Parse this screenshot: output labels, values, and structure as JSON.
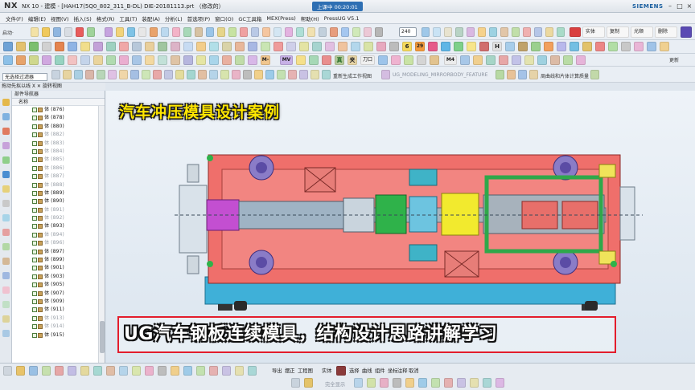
{
  "app": {
    "logo": "NX",
    "title": "NX 10 - 建模 - [HAH17(5Q0_802_311_B-DL) DIE-20181113.prt （修改的）",
    "timer": "上课中 00:20:01",
    "brand": "SIEMENS"
  },
  "menu": [
    "文件(F)",
    "编辑(E)",
    "视图(V)",
    "插入(S)",
    "格式(R)",
    "工具(T)",
    "装配(A)",
    "分析(L)",
    "首选项(P)",
    "窗口(O)",
    "GC工具箱",
    "MEX(Press)",
    "帮助(H)",
    "PressUG V5.1"
  ],
  "toolbar": {
    "start_label": "启动·",
    "zoom_value": "240",
    "right_labels": [
      "实体",
      "复制",
      "光顺",
      "删除"
    ],
    "row3_right": "更新",
    "row4_labels": [
      "重新生成工作视图",
      "UG_MODELING_MIRRORBODY_FEATURE",
      "周曲线和片体计算质量"
    ],
    "glyphs": [
      "6",
      "29",
      "H",
      "M-",
      "MV",
      "真",
      "夹",
      "刀口",
      "M4"
    ]
  },
  "filter": {
    "label": "无选择过滤器"
  },
  "selector": {
    "label": "拖动先拟以线 X ✕ 旋转视图"
  },
  "navigator": {
    "header": "部件导航器",
    "column": "名称",
    "rows": [
      {
        "label": "体 (876)",
        "muted": false
      },
      {
        "label": "体 (878)",
        "muted": false
      },
      {
        "label": "体 (880)",
        "muted": false
      },
      {
        "label": "体 (882)",
        "muted": true
      },
      {
        "label": "体 (883)",
        "muted": true
      },
      {
        "label": "体 (884)",
        "muted": true
      },
      {
        "label": "体 (885)",
        "muted": true
      },
      {
        "label": "体 (886)",
        "muted": true
      },
      {
        "label": "体 (887)",
        "muted": true
      },
      {
        "label": "体 (888)",
        "muted": true
      },
      {
        "label": "体 (889)",
        "muted": false
      },
      {
        "label": "体 (890)",
        "muted": false
      },
      {
        "label": "体 (891)",
        "muted": true
      },
      {
        "label": "体 (892)",
        "muted": true
      },
      {
        "label": "体 (893)",
        "muted": false
      },
      {
        "label": "体 (894)",
        "muted": true
      },
      {
        "label": "体 (896)",
        "muted": true
      },
      {
        "label": "体 (897)",
        "muted": false
      },
      {
        "label": "体 (899)",
        "muted": false
      },
      {
        "label": "体 (901)",
        "muted": false
      },
      {
        "label": "体 (903)",
        "muted": false
      },
      {
        "label": "体 (905)",
        "muted": false
      },
      {
        "label": "体 (907)",
        "muted": false
      },
      {
        "label": "体 (909)",
        "muted": false
      },
      {
        "label": "体 (911)",
        "muted": false
      },
      {
        "label": "体 (913)",
        "muted": true
      },
      {
        "label": "体 (914)",
        "muted": true
      },
      {
        "label": "体 (915)",
        "muted": false
      }
    ]
  },
  "overlay": {
    "title": "汽车冲压模具设计案例",
    "subtitle": "UG汽车钢板连续模具，结构设计思路讲解学习"
  },
  "bottombar": {
    "labels": [
      "导出",
      "摆正",
      "工程图",
      "实体",
      "选择",
      "曲线",
      "组件",
      "坐标",
      "注释",
      "取消"
    ],
    "hint": "完全显示"
  },
  "colors": {
    "title_yellow": "#ffe600",
    "subtitle_border": "#e31d2c",
    "die_plate": "#ef6f6b",
    "die_base": "#3fb0d8",
    "accent_blue": "#2e6fb3"
  }
}
